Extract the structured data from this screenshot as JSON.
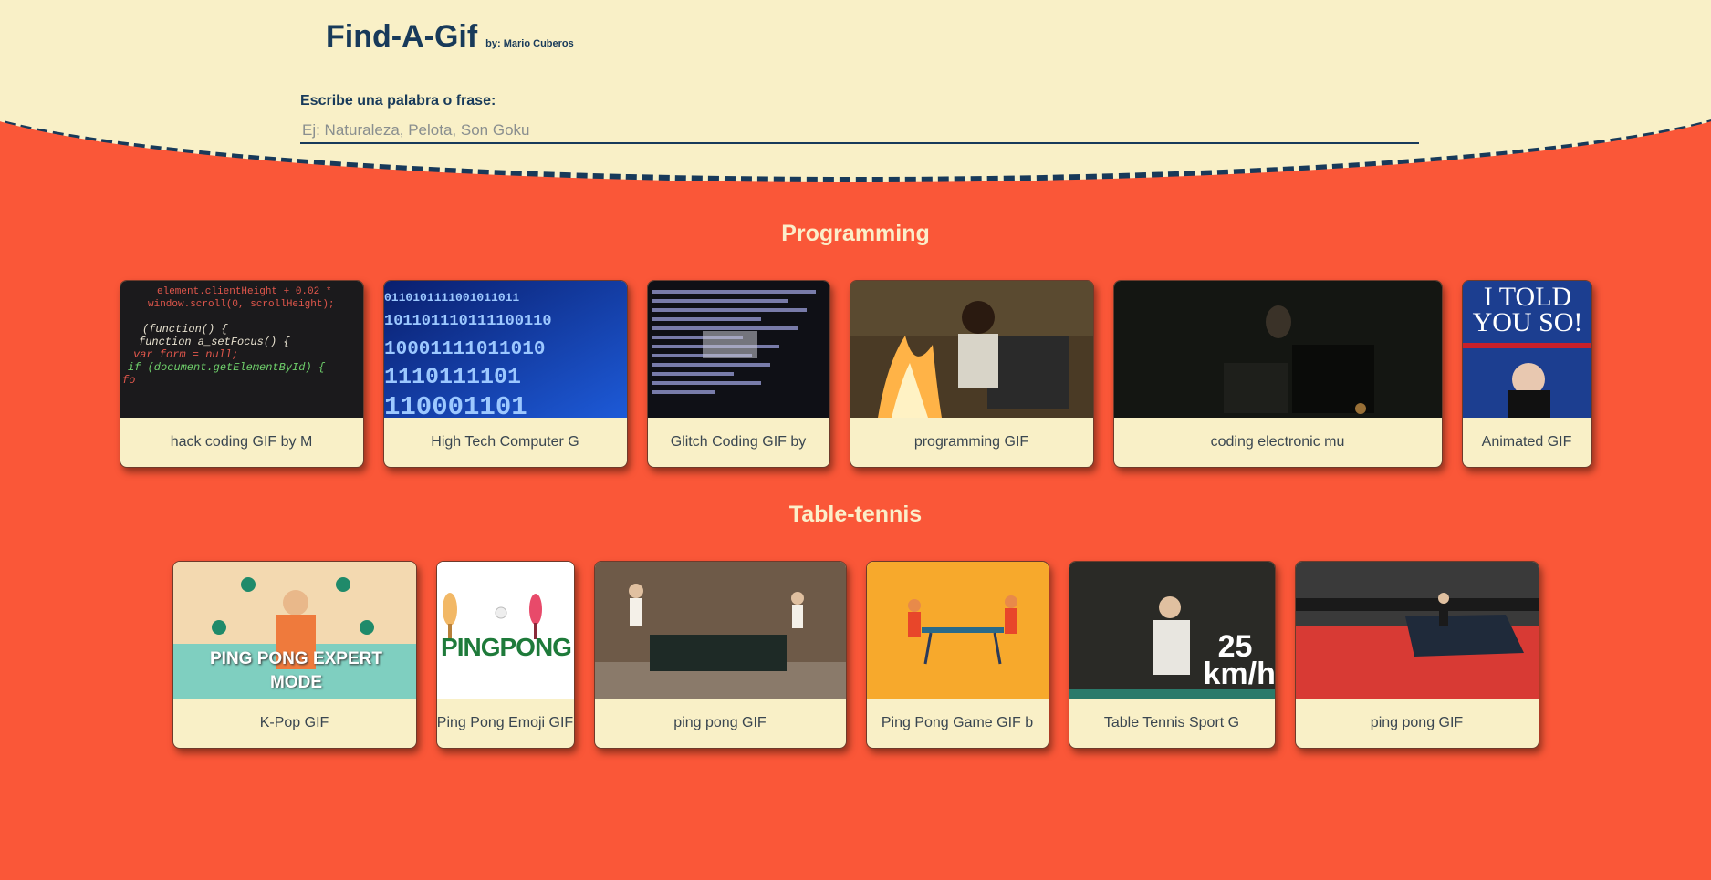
{
  "header": {
    "title": "Find-A-Gif",
    "byline": "by: Mario Cuberos",
    "search_label": "Escribe una palabra o frase:",
    "search_placeholder": "Ej: Naturaleza, Pelota, Son Goku",
    "search_value": ""
  },
  "sections": [
    {
      "title": "Programming",
      "cards": [
        {
          "caption": "hack coding GIF by M"
        },
        {
          "caption": "High Tech Computer G"
        },
        {
          "caption": "Glitch Coding GIF by"
        },
        {
          "caption": "programming GIF"
        },
        {
          "caption": "coding electronic mu"
        },
        {
          "caption": "Animated GIF",
          "overlay": "I TOLD YOU SO!"
        }
      ]
    },
    {
      "title": "Table-tennis",
      "cards": [
        {
          "caption": "K-Pop GIF",
          "overlay": "PING PONG EXPERT MODE"
        },
        {
          "caption": "Ping Pong Emoji GIF",
          "overlay": "PINGPONG"
        },
        {
          "caption": "ping pong GIF"
        },
        {
          "caption": "Ping Pong Game GIF b"
        },
        {
          "caption": "Table Tennis Sport G",
          "overlay": "25 km/h"
        },
        {
          "caption": "ping pong GIF"
        }
      ]
    }
  ],
  "colors": {
    "background": "#fa5738",
    "header": "#f9f0c7",
    "accent": "#183a5a",
    "section_title": "#fbeec9"
  }
}
